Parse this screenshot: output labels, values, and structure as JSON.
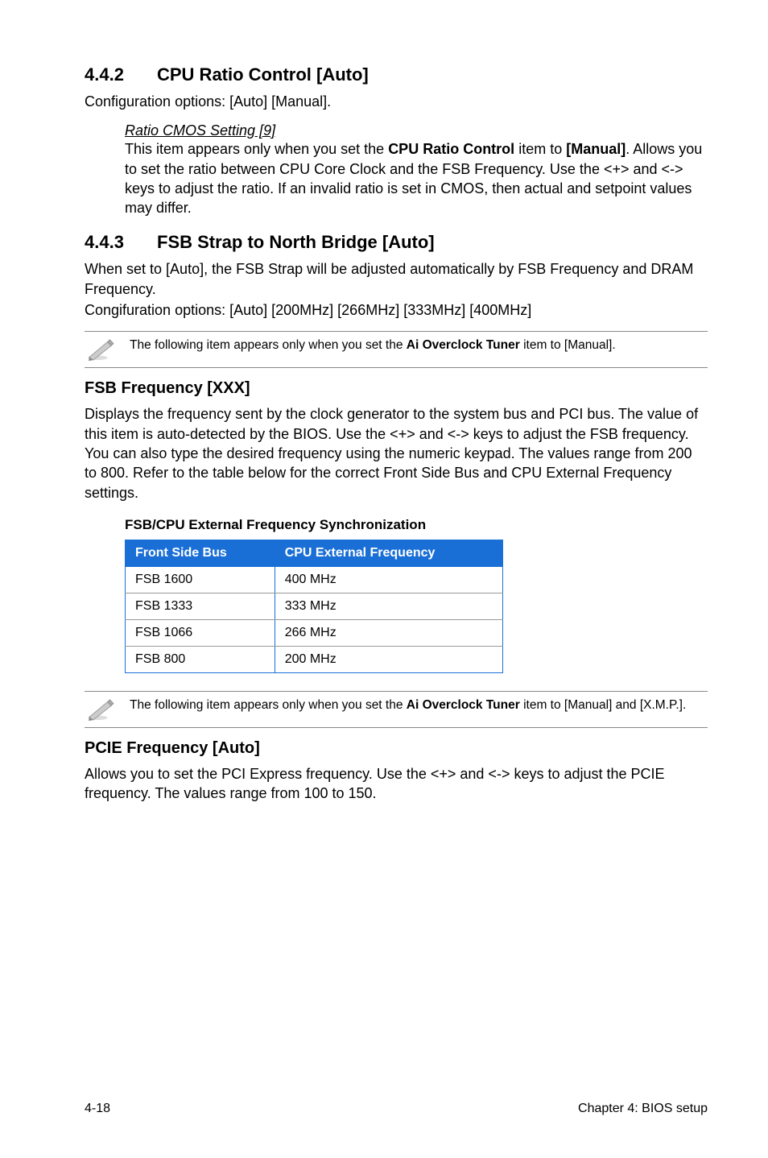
{
  "section_4_4_2": {
    "number": "4.4.2",
    "title": "CPU Ratio Control [Auto]",
    "config": "Configuration options: [Auto] [Manual].",
    "ratio_heading": "Ratio CMOS Setting [9]",
    "ratio_body_1": "This item appears only when you set the ",
    "ratio_body_bold": "CPU Ratio Control",
    "ratio_body_2": " item to ",
    "ratio_body_bold2": "[Manual]",
    "ratio_body_3": ". Allows you to set the ratio between CPU Core Clock and the FSB Frequency. Use the <+> and <-> keys to adjust the ratio. If an invalid ratio is set in CMOS, then actual and setpoint values may differ."
  },
  "section_4_4_3": {
    "number": "4.4.3",
    "title": "FSB Strap to North Bridge [Auto]",
    "body1": "When set to [Auto], the FSB Strap will be adjusted automatically by FSB Frequency and DRAM Frequency.",
    "body2": "Congifuration options: [Auto] [200MHz] [266MHz] [333MHz] [400MHz]"
  },
  "note1": {
    "pre": "The following item appears only when you set the ",
    "bold": "Ai Overclock Tuner",
    "post": " item to [Manual]."
  },
  "fsb_freq": {
    "heading": "FSB Frequency [XXX]",
    "body": "Displays the frequency sent by the clock generator to the system bus and PCI bus. The value of this item is auto-detected by the BIOS. Use the <+> and <-> keys to adjust the FSB frequency. You can also type the desired frequency using the numeric keypad. The values range from 200 to 800. Refer to the table below for the correct Front Side Bus and CPU External Frequency settings."
  },
  "table": {
    "caption": "FSB/CPU External Frequency Synchronization",
    "headers": {
      "col1": "Front Side Bus",
      "col2": "CPU External Frequency"
    },
    "rows": [
      {
        "fsb": "FSB 1600",
        "cpu": "400 MHz"
      },
      {
        "fsb": "FSB 1333",
        "cpu": "333 MHz"
      },
      {
        "fsb": "FSB 1066",
        "cpu": "266 MHz"
      },
      {
        "fsb": "FSB 800",
        "cpu": "200 MHz"
      }
    ]
  },
  "note2": {
    "pre": "The following item appears only when you set the ",
    "bold": "Ai Overclock Tuner",
    "post": " item to [Manual] and [X.M.P.]."
  },
  "pcie": {
    "heading": "PCIE Frequency [Auto]",
    "body": "Allows you to set the PCI Express frequency. Use the <+> and <-> keys to adjust the PCIE frequency. The values range from 100 to 150."
  },
  "footer": {
    "page": "4-18",
    "chapter": "Chapter 4: BIOS setup"
  },
  "chart_data": {
    "type": "table",
    "title": "FSB/CPU External Frequency Synchronization",
    "columns": [
      "Front Side Bus",
      "CPU External Frequency"
    ],
    "rows": [
      [
        "FSB 1600",
        "400 MHz"
      ],
      [
        "FSB 1333",
        "333 MHz"
      ],
      [
        "FSB 1066",
        "266 MHz"
      ],
      [
        "FSB 800",
        "200 MHz"
      ]
    ]
  }
}
